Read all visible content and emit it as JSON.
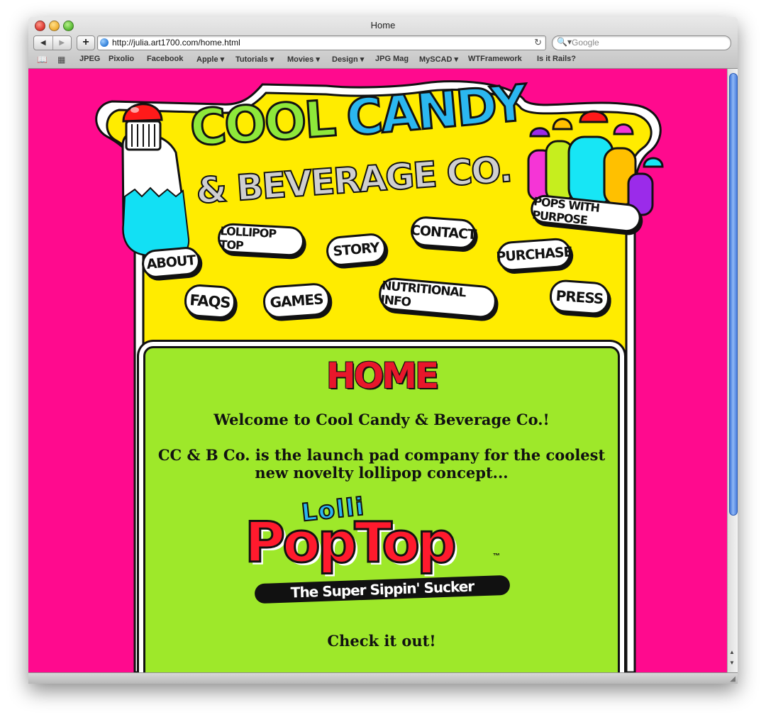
{
  "window": {
    "title": "Home"
  },
  "toolbar": {
    "back_icon": "back-arrow-icon",
    "forward_icon": "forward-arrow-icon",
    "add_label": "+",
    "url": "http://julia.art1700.com/home.html",
    "reload_icon": "reload-icon",
    "search_placeholder": "Google"
  },
  "bookmarks": [
    {
      "label": "JPEG"
    },
    {
      "label": "Pixolio"
    },
    {
      "label": "Facebook"
    },
    {
      "label": "Apple ▾"
    },
    {
      "label": "Tutorials ▾"
    },
    {
      "label": "Movies ▾"
    },
    {
      "label": "Design ▾"
    },
    {
      "label": "JPG Mag"
    },
    {
      "label": "MySCAD ▾"
    },
    {
      "label": "WTFramework"
    },
    {
      "label": "Is it Rails?"
    }
  ],
  "header": {
    "logo_line1a": "COOL",
    "logo_line1b": "CANDY",
    "logo_line2": "& BEVERAGE CO.",
    "tagline": "POPS WITH PURPOSE"
  },
  "nav": {
    "about": "ABOUT",
    "lollipop_top": "LOLLIPOP TOP",
    "story": "STORY",
    "contact": "CONTACT",
    "purchase": "PURCHASE",
    "faqs": "FAQS",
    "games": "GAMES",
    "nutritional_info": "NUTRITIONAL INFO",
    "press": "PRESS"
  },
  "content": {
    "heading": "HOME",
    "welcome": "Welcome to Cool Candy & Beverage Co.!",
    "intro_line1": "CC & B Co. is the launch pad company for the coolest",
    "intro_line2": "new novelty lollipop concept...",
    "product_logo_top": "Lolli",
    "product_logo_main": "PopTop",
    "product_tm": "™",
    "product_tagline": "The Super Sippin' Sucker",
    "cta": "Check it out!"
  },
  "colors": {
    "page_bg": "#ff0a8e",
    "panel_yellow": "#ffec00",
    "content_green": "#9ee82a",
    "logo_green": "#8ee83a",
    "logo_blue": "#2bb7f0",
    "heading_red": "#e8172b",
    "bottle_cyan": "#12e0f4"
  }
}
